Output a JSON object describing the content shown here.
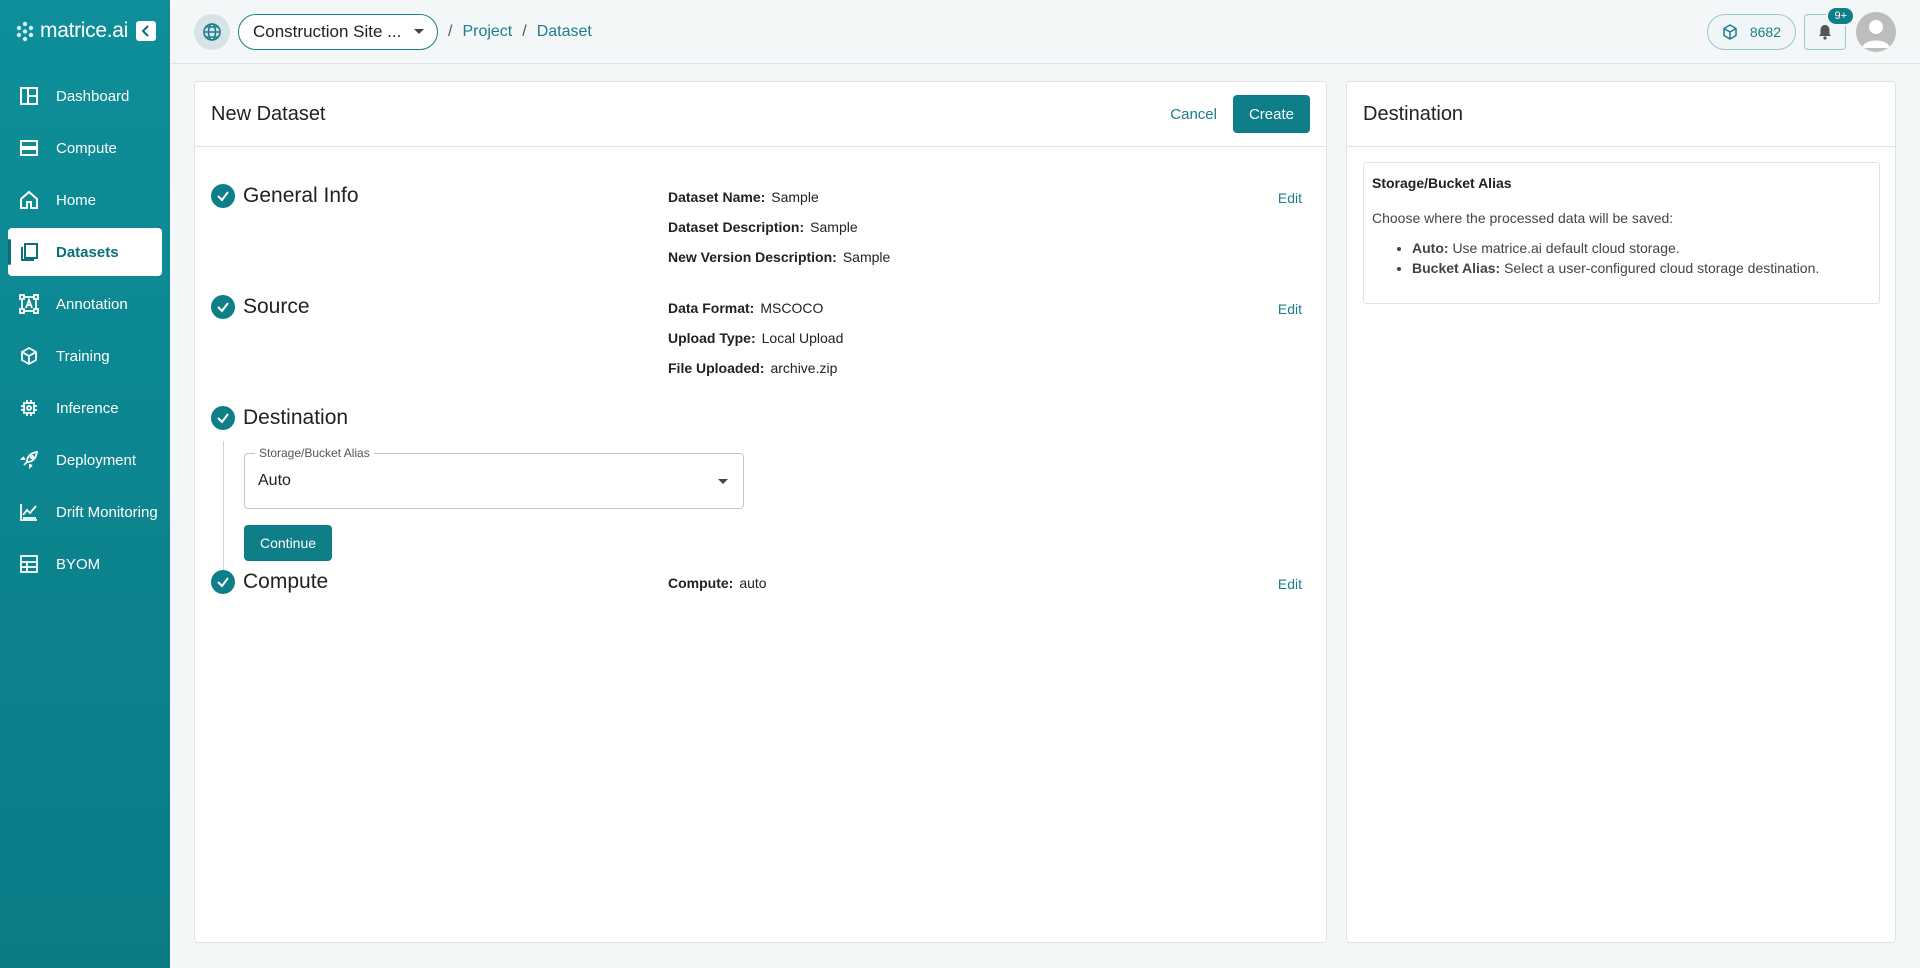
{
  "brand": {
    "name": "matrice.ai"
  },
  "sidebar": {
    "items": [
      {
        "label": "Dashboard",
        "icon": "dashboard-icon"
      },
      {
        "label": "Compute",
        "icon": "server-icon"
      },
      {
        "label": "Home",
        "icon": "home-icon"
      },
      {
        "label": "Datasets",
        "icon": "dataset-icon",
        "active": true
      },
      {
        "label": "Annotation",
        "icon": "annotation-icon"
      },
      {
        "label": "Training",
        "icon": "cube-icon"
      },
      {
        "label": "Inference",
        "icon": "chip-icon"
      },
      {
        "label": "Deployment",
        "icon": "rocket-icon"
      },
      {
        "label": "Drift Monitoring",
        "icon": "chart-line-icon"
      },
      {
        "label": "BYOM",
        "icon": "model-icon"
      }
    ]
  },
  "topbar": {
    "project_select": "Construction Site ...",
    "breadcrumb": [
      "Project",
      "Dataset"
    ],
    "credits": "8682",
    "notification_badge": "9+"
  },
  "main": {
    "title": "New Dataset",
    "cancel_label": "Cancel",
    "create_label": "Create",
    "edit_label": "Edit",
    "steps": {
      "general": {
        "title": "General Info",
        "fields": [
          {
            "label": "Dataset Name:",
            "value": "Sample"
          },
          {
            "label": "Dataset Description:",
            "value": "Sample"
          },
          {
            "label": "New Version Description:",
            "value": "Sample"
          }
        ]
      },
      "source": {
        "title": "Source",
        "fields": [
          {
            "label": "Data Format:",
            "value": "MSCOCO"
          },
          {
            "label": "Upload Type:",
            "value": "Local Upload"
          },
          {
            "label": "File Uploaded:",
            "value": "archive.zip"
          }
        ]
      },
      "destination": {
        "title": "Destination",
        "select_label": "Storage/Bucket Alias",
        "select_value": "Auto",
        "continue_label": "Continue"
      },
      "compute": {
        "title": "Compute",
        "fields": [
          {
            "label": "Compute:",
            "value": "auto"
          }
        ]
      }
    }
  },
  "side": {
    "title": "Destination",
    "box_title": "Storage/Bucket Alias",
    "box_desc": "Choose where the processed data will be saved:",
    "options": [
      {
        "name": "Auto:",
        "desc": "Use matrice.ai default cloud storage."
      },
      {
        "name": "Bucket Alias:",
        "desc": "Select a user-configured cloud storage destination."
      }
    ]
  },
  "colors": {
    "primary": "#0e7f89",
    "sidebar": "#0e8f99"
  }
}
